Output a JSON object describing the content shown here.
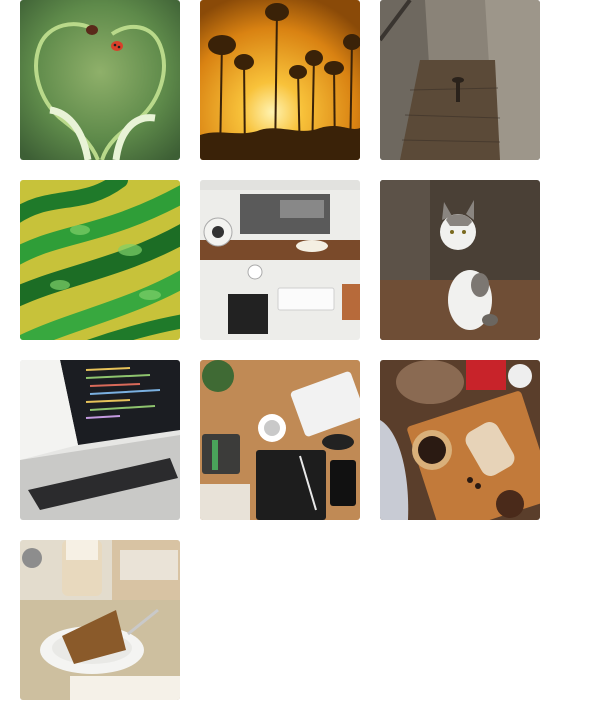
{
  "gallery": {
    "items": [
      {
        "name": "ladybugs-on-heart-stems"
      },
      {
        "name": "sunset-through-pine-trees"
      },
      {
        "name": "rusty-nail-on-wooden-plank"
      },
      {
        "name": "green-yellow-abstract-3d"
      },
      {
        "name": "desk-with-keyboard-and-speaker"
      },
      {
        "name": "white-gray-cat-sitting"
      },
      {
        "name": "laptop-with-code"
      },
      {
        "name": "flatlay-desk-with-notebook"
      },
      {
        "name": "cake-and-coffee-on-cutting-board"
      },
      {
        "name": "sponge-cake-and-latte"
      }
    ]
  }
}
